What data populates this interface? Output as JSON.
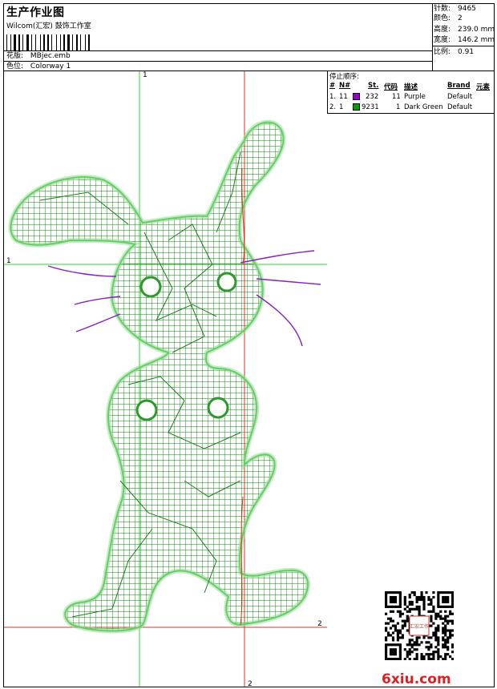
{
  "header": {
    "title": "生产作业图",
    "company": "Wilcom(汇宏) 鼓饰工作室",
    "pattern_label": "花版:",
    "pattern_value": "MBjec.emb",
    "colorway_label": "色位:",
    "colorway_value": "Colorway 1"
  },
  "stats": [
    {
      "label": "针数:",
      "value": "9465"
    },
    {
      "label": "颜色:",
      "value": "2"
    },
    {
      "label": "高度:",
      "value": "239.0 mm"
    },
    {
      "label": "宽度:",
      "value": "146.2 mm"
    },
    {
      "label": "比例:",
      "value": "0.91"
    }
  ],
  "stop_sequence": {
    "title": "停止顺序:",
    "headers": {
      "num": "#",
      "n": "N#",
      "st": "St.",
      "code": "代码",
      "desc": "描述",
      "brand": "Brand",
      "elem": "元素"
    },
    "rows": [
      {
        "num": "1.",
        "n": "11",
        "color": "#9b00c8",
        "st": "232",
        "code": "11",
        "desc": "Purple",
        "brand": "Default"
      },
      {
        "num": "2.",
        "n": "1",
        "color": "#00a000",
        "st": "9231",
        "code": "1",
        "desc": "Dark Green",
        "brand": "Default"
      }
    ]
  },
  "guides": {
    "green_v": "1",
    "green_h": "1",
    "red_v": "2",
    "red_h": "2"
  },
  "watermark": "6xiu.com",
  "qr_stamp": "汇宏工作"
}
